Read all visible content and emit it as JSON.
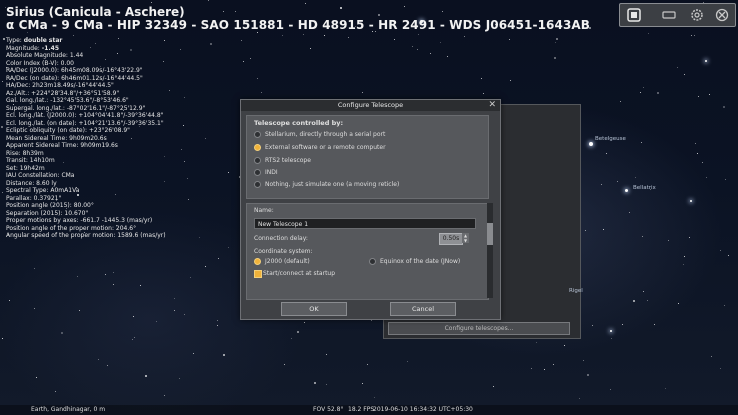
{
  "object": {
    "title": "Sirius (Canicula - Aschere)",
    "designations": "α CMa - 9 CMa - HIP 32349 - SAO 151881 - HD 48915 - HR 2491 - WDS J06451-1643AB",
    "type_label": "Type: ",
    "type_value": "double star",
    "magnitude_label": "Magnitude: ",
    "magnitude_value": "-1.45",
    "details": [
      "Absolute Magnitude: 1.44",
      "Color Index (B-V): 0.00",
      "RA/Dec (J2000.0): 6h45m08.09s/-16°43'22.9\"",
      "RA/Dec (on date): 6h46m01.12s/-16°44'44.5\"",
      "HA/Dec: 2h23m18.49s/-16°44'44.5\"",
      "Az./Alt.: +224°28'34.8\"/+36°51'58.9\"",
      "Gal. long./lat.: -132°45'53.6\"/-8°53'46.6\"",
      "Supergal. long./lat.: -87°02'16.1\"/-87°25'12.9\"",
      "Ecl. long./lat. (J2000.0): +104°04'41.8\"/-39°36'44.8\"",
      "Ecl. long./lat. (on date): +104°21'13.6\"/-39°36'35.1\"",
      "Ecliptic obliquity (on date): +23°26'08.9\"",
      "Mean Sidereal Time: 9h09m20.6s",
      "Apparent Sidereal Time: 9h09m19.6s",
      "Rise: 8h39m",
      "Transit: 14h10m",
      "Set: 19h42m",
      "IAU Constellation: CMa",
      "Distance: 8.60 ly",
      "Spectral Type: A0mA1Va",
      "Parallax: 0.37921\"",
      "Position angle (2015): 80.00°",
      "Separation (2015): 10.670\"",
      "Proper motions by axes: -661.7 -1445.3 (mas/yr)",
      "Position angle of the proper motion: 204.6°",
      "Angular speed of the proper motion: 1589.6 (mas/yr)"
    ]
  },
  "dialog": {
    "title": "Configure Telescope",
    "controlled_by_heading": "Telescope controlled by:",
    "control_options": [
      "Stellarium, directly through a serial port",
      "External software or a remote computer",
      "RTS2 telescope",
      "INDI",
      "Nothing, just simulate one (a moving reticle)"
    ],
    "selected_control_index": 1,
    "name_label": "Name:",
    "name_value": "New Telescope 1",
    "delay_label": "Connection delay:",
    "delay_value": "0.50s",
    "coord_label": "Coordinate system:",
    "coord_options": [
      "J2000 (default)",
      "Equinox of the date (JNow)"
    ],
    "selected_coord_index": 0,
    "startup_label": "Start/connect at startup",
    "startup_checked": true,
    "ok_label": "OK",
    "cancel_label": "Cancel"
  },
  "background_window": {
    "configure_button_label": "Configure telescopes..."
  },
  "sky_labels": {
    "betelgeuse": "Betelgeuse",
    "bellatrix": "Bellatrix",
    "rigel": "Rigel"
  },
  "status_bar": {
    "location": "Earth, Gandhinagar, 0 m",
    "fov": "FOV 52.8°",
    "fps": "18.2 FPS",
    "datetime": "2019-06-10 16:34:32 UTC+05:30"
  },
  "colors": {
    "accent": "#f0b23a",
    "dialog_bg": "#3f4145",
    "sky": "#0b1324"
  }
}
